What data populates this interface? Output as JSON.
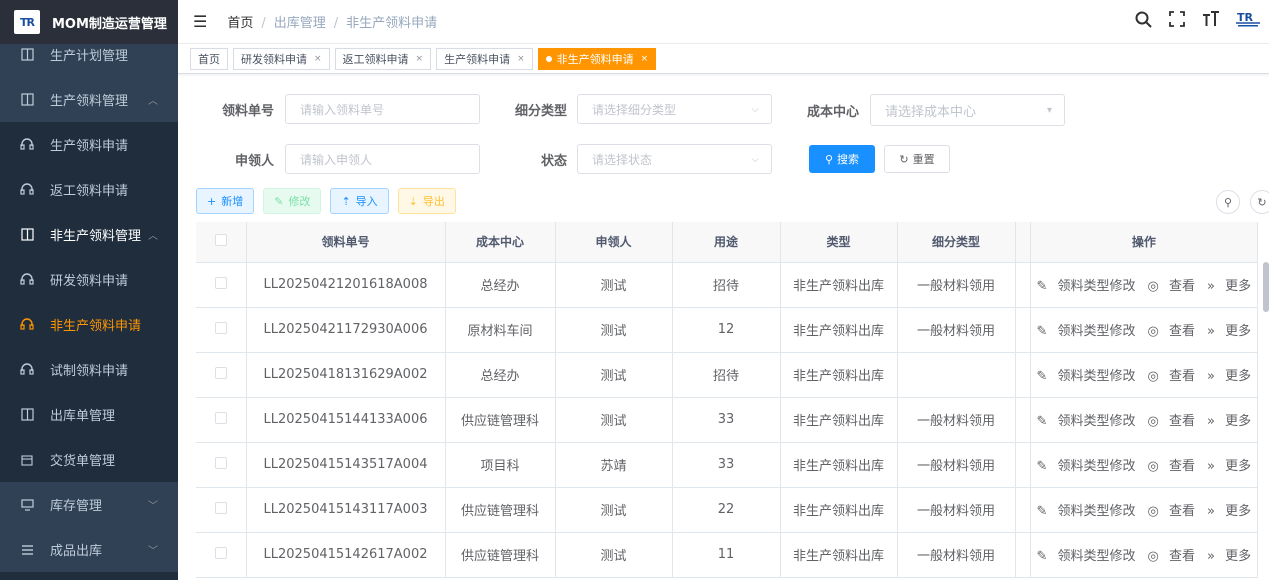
{
  "app": {
    "title": "MOM制造运营管理",
    "logo_text": "TR"
  },
  "sidebar": {
    "items": [
      {
        "label": "生产计划管理",
        "icon": "book-icon",
        "kind": "top"
      },
      {
        "label": "生产领料管理",
        "icon": "book-icon",
        "kind": "top",
        "arrow": "^"
      },
      {
        "label": "生产领料申请",
        "icon": "headset-icon",
        "kind": "sub"
      },
      {
        "label": "返工领料申请",
        "icon": "headset-icon",
        "kind": "sub"
      },
      {
        "label": "非生产领料管理",
        "icon": "book-icon",
        "kind": "parent",
        "arrow": "^"
      },
      {
        "label": "研发领料申请",
        "icon": "headset-icon",
        "kind": "sub"
      },
      {
        "label": "非生产领料申请",
        "icon": "headset-icon",
        "kind": "sub",
        "active": true
      },
      {
        "label": "试制领料申请",
        "icon": "headset-icon",
        "kind": "sub"
      },
      {
        "label": "出库单管理",
        "icon": "book-icon",
        "kind": "sub"
      },
      {
        "label": "交货单管理",
        "icon": "calendar-icon",
        "kind": "sub"
      },
      {
        "label": "库存管理",
        "icon": "monitor-icon",
        "kind": "top",
        "arrow": "v"
      },
      {
        "label": "成品出库",
        "icon": "list-icon",
        "kind": "top",
        "arrow": "v"
      }
    ]
  },
  "navbar": {
    "breadcrumb": [
      "首页",
      "出库管理",
      "非生产领料申请"
    ]
  },
  "tags": [
    {
      "label": "首页",
      "closable": false
    },
    {
      "label": "研发领料申请",
      "closable": true
    },
    {
      "label": "返工领料申请",
      "closable": true
    },
    {
      "label": "生产领料申请",
      "closable": true
    },
    {
      "label": "非生产领料申请",
      "closable": true,
      "active": true
    }
  ],
  "search": {
    "order_no": {
      "label": "领料单号",
      "placeholder": "请输入领料单号"
    },
    "sub_type": {
      "label": "细分类型",
      "placeholder": "请选择细分类型"
    },
    "cost_center": {
      "label": "成本中心",
      "placeholder": "请选择成本中心"
    },
    "applicant": {
      "label": "申领人",
      "placeholder": "请输入申领人"
    },
    "status": {
      "label": "状态",
      "placeholder": "请选择状态"
    },
    "search_btn": "搜索",
    "reset_btn": "重置"
  },
  "toolbar": {
    "add": "新增",
    "edit": "修改",
    "import": "导入",
    "export": "导出"
  },
  "table": {
    "columns": [
      "",
      "领料单号",
      "成本中心",
      "申领人",
      "用途",
      "类型",
      "细分类型",
      "",
      "操作"
    ],
    "op_labels": {
      "edit_type": "领料类型修改",
      "view": "查看",
      "more": "更多"
    },
    "rows": [
      {
        "no": "LL20250421201618A008",
        "center": "总经办",
        "person": "测试",
        "use": "招待",
        "type": "非生产领料出库",
        "sub": "一般材料领用"
      },
      {
        "no": "LL20250421172930A006",
        "center": "原材料车间",
        "person": "测试",
        "use": "12",
        "type": "非生产领料出库",
        "sub": "一般材料领用"
      },
      {
        "no": "LL20250418131629A002",
        "center": "总经办",
        "person": "测试",
        "use": "招待",
        "type": "非生产领料出库",
        "sub": ""
      },
      {
        "no": "LL20250415144133A006",
        "center": "供应链管理科",
        "person": "测试",
        "use": "33",
        "type": "非生产领料出库",
        "sub": "一般材料领用"
      },
      {
        "no": "LL20250415143517A004",
        "center": "项目科",
        "person": "苏靖",
        "use": "33",
        "type": "非生产领料出库",
        "sub": "一般材料领用"
      },
      {
        "no": "LL20250415143117A003",
        "center": "供应链管理科",
        "person": "测试",
        "use": "22",
        "type": "非生产领料出库",
        "sub": "一般材料领用"
      },
      {
        "no": "LL20250415142617A002",
        "center": "供应链管理科",
        "person": "测试",
        "use": "11",
        "type": "非生产领料出库",
        "sub": "一般材料领用"
      }
    ]
  }
}
